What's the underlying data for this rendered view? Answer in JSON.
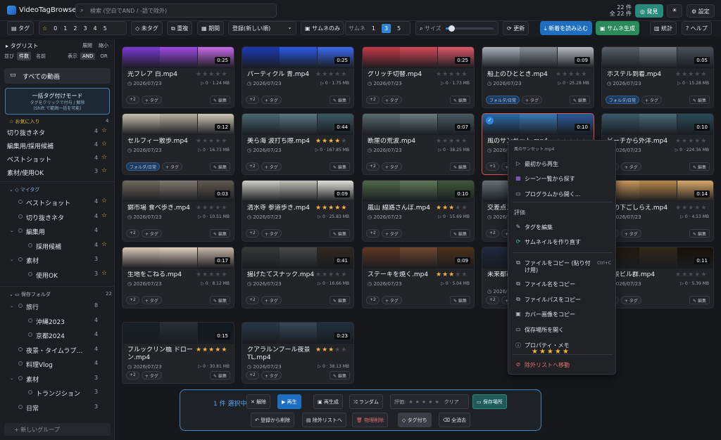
{
  "app": {
    "title": "VideoTagBrowser2"
  },
  "search": {
    "placeholder": "検索 (空白でAND / -語で除外)"
  },
  "counts": {
    "line1": "22 件",
    "line2": "全 22 件"
  },
  "header_buttons": {
    "discover": "発見",
    "settings": "設定"
  },
  "toolbar": {
    "tag": "タグ",
    "star_levels": [
      "0",
      "1",
      "2",
      "3",
      "4",
      "5"
    ],
    "untagged": "未タグ",
    "duplicates": "重複",
    "period": "期間",
    "sort_value": "登録(新しい順)",
    "thumb_only": "サムネのみ",
    "thumb_label": "サムネ",
    "thumb_options": [
      "1",
      "3",
      "5"
    ],
    "thumb_active": "3",
    "size_label": "サイズ",
    "size_level": 0.12,
    "refresh": "更新",
    "import_new": "新着を読み込む",
    "gen_thumbs": "サムネ生成",
    "stats": "統計",
    "help": "ヘルプ"
  },
  "sidebar": {
    "title": "タグリスト",
    "expand": "展開",
    "collapse": "縮小",
    "sort_label": "並び",
    "sort_options": [
      "件数",
      "名前"
    ],
    "mode_label": "表示",
    "mode_options": [
      "AND",
      "OR"
    ],
    "all_videos": "すべての動画",
    "bulk_title": "一括タグ付けモード",
    "bulk_sub1": "タグをクリックで付与 / 解除",
    "bulk_sub2": "(Shift で範囲一括を可能)",
    "favorites_label": "お気に入り",
    "favorites_count": "4",
    "favorites": [
      {
        "label": "切り抜きネタ",
        "count": "4"
      },
      {
        "label": "編集用/採用候補",
        "count": "4"
      },
      {
        "label": "ベストショット",
        "count": "4"
      },
      {
        "label": "素材/使用OK",
        "count": "3"
      }
    ],
    "mytags_label": "マイタグ",
    "mytags": [
      {
        "label": "ベストショット",
        "count": "4",
        "indent": 1,
        "star": true
      },
      {
        "label": "切り抜きネタ",
        "count": "4",
        "indent": 1,
        "star": true
      },
      {
        "label": "編集用",
        "count": "4",
        "indent": 1,
        "arrow": true
      },
      {
        "label": "採用候補",
        "count": "4",
        "indent": 2,
        "star": true
      },
      {
        "label": "素材",
        "count": "3",
        "indent": 1,
        "arrow": true
      },
      {
        "label": "使用OK",
        "count": "3",
        "indent": 2,
        "star": true
      }
    ],
    "folders_label": "保存フォルダ",
    "folders_count": "22",
    "folders": [
      {
        "label": "旅行",
        "count": "8",
        "indent": 1,
        "arrow": true
      },
      {
        "label": "沖縄2023",
        "count": "4",
        "indent": 2
      },
      {
        "label": "京都2024",
        "count": "4",
        "indent": 2
      },
      {
        "label": "夜景・タイムラプ…",
        "count": "4",
        "indent": 1
      },
      {
        "label": "料理Vlog",
        "count": "4",
        "indent": 1
      },
      {
        "label": "素材",
        "count": "3",
        "indent": 1,
        "arrow": true
      },
      {
        "label": "トランジション",
        "count": "3",
        "indent": 2
      },
      {
        "label": "日常",
        "count": "3",
        "indent": 1
      }
    ],
    "new_group": "+ 新しいグループ"
  },
  "cards": [
    {
      "title": "光フレア 白.mp4",
      "dur": "0:25",
      "rating": 0,
      "date": "2026/07/23",
      "size": "1.24 MB",
      "tags": [
        "+2"
      ],
      "thumb": [
        "#7a3ad8",
        "#a04ae8",
        "#c86ae8"
      ]
    },
    {
      "title": "パーティクル 青.mp4",
      "dur": "0:25",
      "rating": 0,
      "date": "2026/07/23",
      "size": "1.75 MB",
      "tags": [
        "+2"
      ],
      "thumb": [
        "#1a3ab8",
        "#2a5ae8",
        "#3a6af0"
      ]
    },
    {
      "title": "グリッチ切替.mp4",
      "dur": "0:25",
      "rating": 0,
      "date": "2026/07/23",
      "size": "1.73 MB",
      "tags": [
        "+2"
      ],
      "thumb": [
        "#c83848",
        "#d84858",
        "#e05868"
      ]
    },
    {
      "title": "船上のひととき.mp4",
      "dur": "0:09",
      "rating": 0,
      "date": "2026/07/23",
      "size": "25.28 MB",
      "tags": [
        "フォルダ/日常"
      ],
      "thumb": [
        "#a8b0b8",
        "#8a9098",
        "#b8bcc0"
      ]
    },
    {
      "title": "ホステル到着.mp4",
      "dur": "0:05",
      "rating": 0,
      "date": "2026/07/23",
      "size": "15.28 MB",
      "tags": [
        "フォルダ/日常"
      ],
      "thumb": [
        "#5a6068",
        "#707880",
        "#4a5058"
      ]
    },
    {
      "title": "セルフィー散歩.mp4",
      "dur": "0:12",
      "rating": 0,
      "date": "2026/07/23",
      "size": "16.73 MB",
      "tags": [
        "フォルダ/日常"
      ],
      "thumb": [
        "#c8c0b0",
        "#b8b0a0",
        "#d0c8b8"
      ]
    },
    {
      "title": "美ら海 波打ち際.mp4",
      "dur": "0:44",
      "rating": 4,
      "date": "2026/07/23",
      "size": "167.85 MB",
      "tags": [
        "+2"
      ],
      "thumb": [
        "#4a6870",
        "#5a7880",
        "#3a5860"
      ]
    },
    {
      "title": "断崖の荒波.mp4",
      "dur": "0:07",
      "rating": 0,
      "date": "2026/07/23",
      "size": "38.25 MB",
      "tags": [
        "+2"
      ],
      "thumb": [
        "#5a6a70",
        "#6a7a80",
        "#4a5a60"
      ]
    },
    {
      "title": "風のサンセット.mp4",
      "dur": "0:10",
      "rating": 0,
      "date": "2026/07/23",
      "size": "12.3 MB",
      "tags": [
        "+1"
      ],
      "thumb": [
        "#2a6aa8",
        "#3a7ab8",
        "#2a5a98"
      ],
      "selected": true
    },
    {
      "title": "ビーチから外洋.mp4",
      "dur": "0:10",
      "rating": 0,
      "date": "2026/07/23",
      "size": "224.36 MB",
      "tags": [
        "+2"
      ],
      "thumb": [
        "#3a5a68",
        "#4a6a78",
        "#2a4a58"
      ]
    },
    {
      "title": "錦市場 食べ歩き.mp4",
      "dur": "0:03",
      "rating": 0,
      "date": "2026/07/23",
      "size": "10.51 MB",
      "tags": [
        "+2"
      ],
      "thumb": [
        "#706860",
        "#807870",
        "#605850"
      ]
    },
    {
      "title": "清水寺 参道歩き.mp4",
      "dur": "0:09",
      "rating": 5,
      "date": "2026/07/23",
      "size": "25.83 MB",
      "tags": [
        "+2"
      ],
      "thumb": [
        "#d0d0c8",
        "#c0c0b8",
        "#e0e0d8"
      ]
    },
    {
      "title": "嵐山 線路さんぽ.mp4",
      "dur": "0:10",
      "rating": 3,
      "date": "2026/07/23",
      "size": "15.69 MB",
      "tags": [
        "+2"
      ],
      "thumb": [
        "#506848",
        "#607858",
        "#405838"
      ]
    },
    {
      "title": "交差点スクランブル.mp4",
      "dur": "0:12",
      "rating": 0,
      "date": "2026/07/23",
      "size": "9.8 MB",
      "tags": [
        "+2"
      ],
      "thumb": [
        "#687078",
        "#788088",
        "#586068"
      ]
    },
    {
      "title": "朝の下ごしらえ.mp4",
      "dur": "0:14",
      "rating": 0,
      "date": "2026/07/23",
      "size": "4.53 MB",
      "tags": [
        "+2"
      ],
      "thumb": [
        "#c89858",
        "#b88848",
        "#d8a868"
      ]
    },
    {
      "title": "生地をこねる.mp4",
      "dur": "0:17",
      "rating": 0,
      "date": "2026/07/23",
      "size": "8.12 MB",
      "tags": [
        "+2"
      ],
      "thumb": [
        "#d8c8b8",
        "#e0d0c0",
        "#c8b8a8"
      ]
    },
    {
      "title": "揚げたてスナック.mp4",
      "dur": "0:41",
      "rating": 0,
      "date": "2026/07/23",
      "size": "16.66 MB",
      "tags": [
        "+2"
      ],
      "thumb": [
        "#383838",
        "#484848",
        "#302820"
      ]
    },
    {
      "title": "ステーキを焼く.mp4",
      "dur": "0:09",
      "rating": 3,
      "date": "2026/07/23",
      "size": "5.04 MB",
      "tags": [
        "+2"
      ],
      "thumb": [
        "#603820",
        "#704830",
        "#503018"
      ]
    },
    {
      "title": "未来都市のネオン.mp4",
      "dur": "0:08",
      "rating": 0,
      "date": "2026/07/23",
      "size": "6.2 MB",
      "tags": [
        "+2"
      ],
      "thumb": [
        "#202840",
        "#303850",
        "#182030"
      ],
      "two": true
    },
    {
      "title": "夜景ビル群.mp4",
      "dur": "0:11",
      "rating": 0,
      "date": "2026/07/23",
      "size": "5.39 MB",
      "tags": [
        "+2"
      ],
      "thumb": [
        "#201810",
        "#302818",
        "#181008"
      ]
    },
    {
      "title": "ブルックリン橋 ドローン.mp4",
      "dur": "0:15",
      "rating": 5,
      "date": "2026/07/23",
      "size": "30.81 MB",
      "tags": [
        "+2"
      ],
      "thumb": [
        "#182028",
        "#283038",
        "#101820"
      ],
      "two": true
    },
    {
      "title": "クアラルンプール夜景TL.mp4",
      "dur": "0:23",
      "rating": 3,
      "date": "2026/07/23",
      "size": "38.13 MB",
      "tags": [
        "+2"
      ],
      "thumb": [
        "#283848",
        "#384858",
        "#203040"
      ],
      "two": true
    }
  ],
  "card_labels": {
    "add_tag": "+ タグ",
    "edit": "編集"
  },
  "context_menu": {
    "header": "風のサンセット.mp4",
    "items": [
      {
        "label": "最初から再生",
        "icon": "▷"
      },
      {
        "label": "シーン一覧から探す",
        "icon": "▦"
      },
      {
        "label": "プログラムから開く...",
        "icon": "▭"
      },
      {
        "label": "評価",
        "icon": ""
      },
      {
        "label": "タグを編集",
        "icon": "✎"
      },
      {
        "label": "サムネイルを作り直す",
        "icon": "⟳"
      },
      {
        "label": "ファイルをコピー (貼り付け用)",
        "icon": "⧉",
        "shortcut": "Ctrl+C"
      },
      {
        "label": "ファイル名をコピー",
        "icon": "⧉"
      },
      {
        "label": "ファイルパスをコピー",
        "icon": "⧉"
      },
      {
        "label": "カバー画像をコピー",
        "icon": "▣"
      },
      {
        "label": "保存場所を開く",
        "icon": "▭"
      },
      {
        "label": "プロパティ・メモ",
        "icon": "ⓘ"
      },
      {
        "label": "除外リストへ移動",
        "icon": "⊘"
      }
    ],
    "rating_stars": "★★★★★"
  },
  "bottom_bar": {
    "selected": "1 件 選択中",
    "cancel": "解除",
    "play": "再生",
    "regen": "再生成",
    "random": "ランダム",
    "rating_label": "評価:",
    "clear": "クリア",
    "save_location": "保存場所",
    "remove_reg": "登録から削除",
    "to_exclude": "除外リストへ",
    "physical_delete": "物理削除",
    "tagging": "タグ付ち",
    "clear_all": "全消去"
  },
  "colors": {
    "accent": "#2f86d8",
    "teal": "#2a8a7a",
    "star": "#f2b43a"
  }
}
